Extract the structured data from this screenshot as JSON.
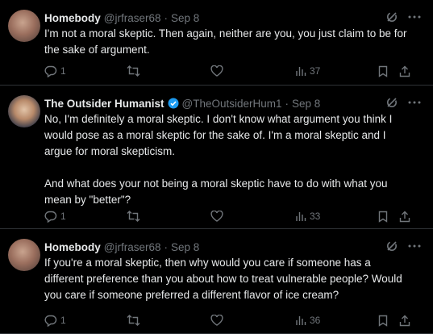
{
  "tweets": [
    {
      "name": "Homebody",
      "handle": "@jrfraser68",
      "dot": "·",
      "date": "Sep 8",
      "verified": false,
      "text": "I'm not a moral skeptic. Then again, neither are you, you just claim to be for\nthe sake of argument.",
      "replies": "1",
      "retweets": "",
      "likes": "",
      "views": "37"
    },
    {
      "name": "The Outsider Humanist",
      "handle": "@TheOutsiderHum1",
      "dot": "·",
      "date": "Sep 8",
      "verified": true,
      "text": "No, I'm definitely a moral skeptic. I don't know what argument you think I\nwould pose as a moral skeptic for the sake of. I'm a moral skeptic and I\nargue for moral skepticism.\n\nAnd what does your not being a moral skeptic have to do with what you\nmean by \"better\"?",
      "replies": "1",
      "retweets": "",
      "likes": "",
      "views": "33"
    },
    {
      "name": "Homebody",
      "handle": "@jrfraser68",
      "dot": "·",
      "date": "Sep 8",
      "verified": false,
      "text": "If you're a moral skeptic, then why would you care if someone has a\ndifferent preference than you about how to treat vulnerable people? Would\nyou care if someone preferred a different flavor of ice cream?",
      "replies": "1",
      "retweets": "",
      "likes": "",
      "views": "36"
    }
  ],
  "icons": {
    "grok": "grok-icon",
    "more": "more-icon",
    "reply": "reply-icon",
    "retweet": "retweet-icon",
    "like": "like-icon",
    "views": "views-icon",
    "bookmark": "bookmark-icon",
    "share": "share-icon",
    "verified": "verified-badge-icon"
  },
  "colors": {
    "background": "#000000",
    "text": "#e7e9ea",
    "muted": "#71767b",
    "divider": "#2f3336",
    "verified": "#1d9bf0"
  }
}
